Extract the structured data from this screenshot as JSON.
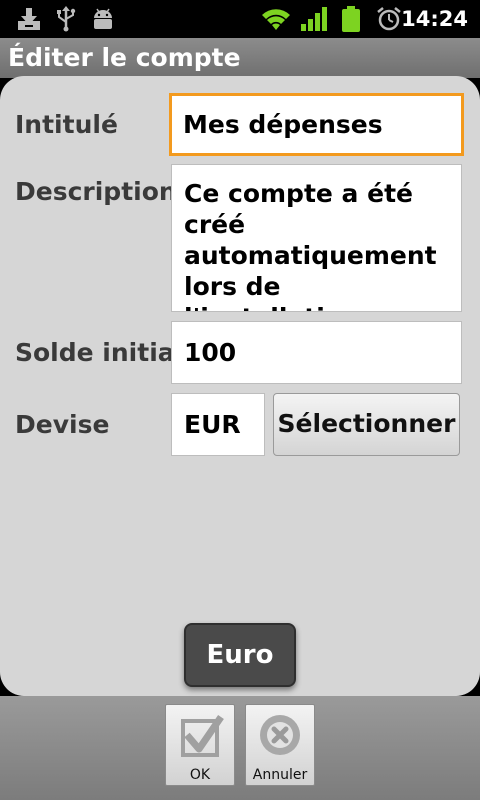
{
  "status_bar": {
    "time": "14:24",
    "icons": [
      "download-icon",
      "usb-icon",
      "android-debug-icon",
      "wifi-icon",
      "signal-icon",
      "battery-icon",
      "alarm-icon"
    ]
  },
  "title": "Éditer le compte",
  "form": {
    "name_label": "Intitulé",
    "name_value": "Mes dépenses",
    "description_label": "Description",
    "description_value": "Ce compte a été créé automatiquement lors de l'installation",
    "initial_balance_label": "Solde initial",
    "initial_balance_value": "100",
    "currency_label": "Devise",
    "currency_value": "EUR",
    "select_button": "Sélectionner"
  },
  "toast": "Euro",
  "bottom_bar": {
    "ok_label": "OK",
    "cancel_label": "Annuler"
  },
  "colors": {
    "focus_border": "#f39a1e",
    "battery": "#7dd321",
    "signal": "#7dd321"
  }
}
